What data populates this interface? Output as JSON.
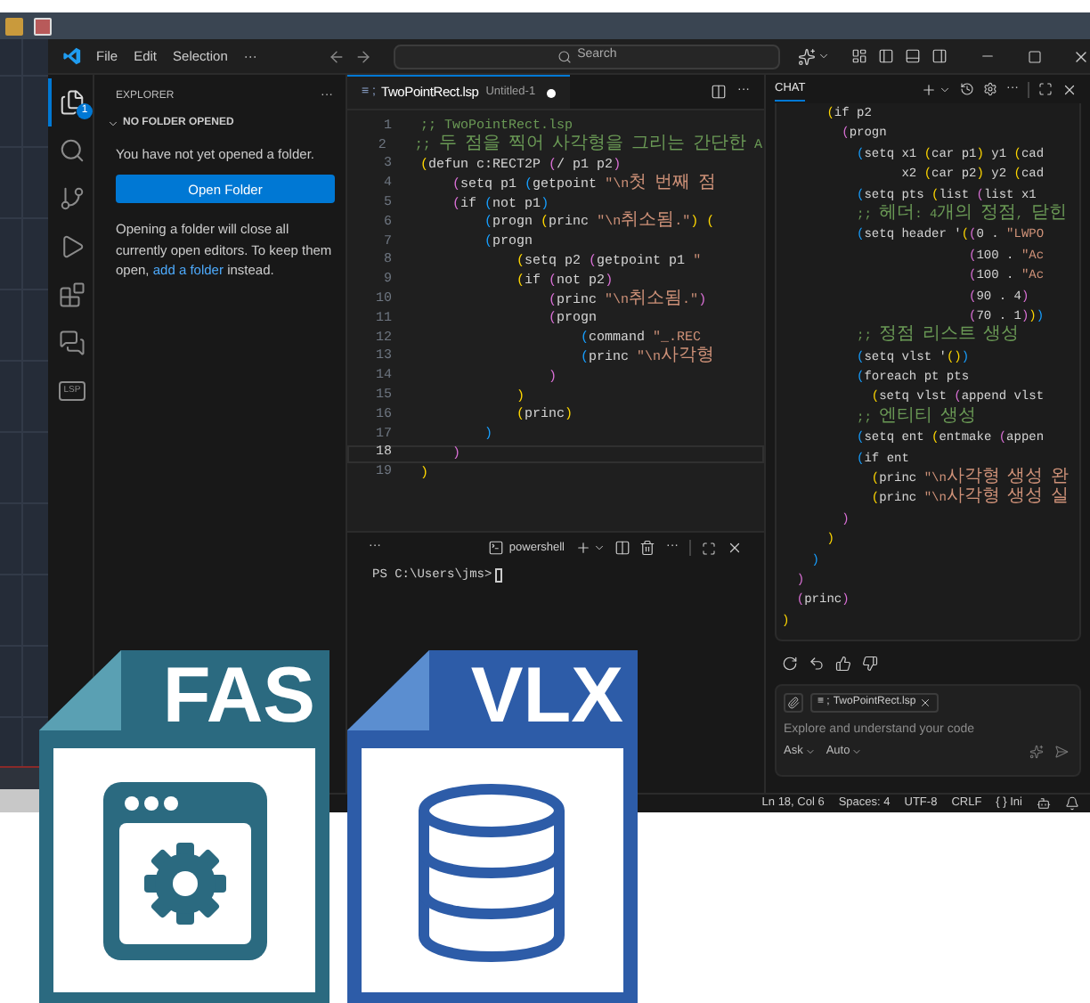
{
  "title_bar": {
    "menu": [
      "File",
      "Edit",
      "Selection",
      "···"
    ],
    "search": {
      "placeholder": "Search"
    }
  },
  "activity_bar": {
    "items": [
      {
        "kind": "files",
        "selected": true,
        "badge": "1"
      },
      {
        "kind": "search",
        "selected": false
      },
      {
        "kind": "source-control",
        "selected": false
      },
      {
        "kind": "run",
        "selected": false
      },
      {
        "kind": "extensions",
        "selected": false
      },
      {
        "kind": "chat",
        "selected": false
      },
      {
        "kind": "lsp",
        "selected": false,
        "label": "LSP"
      }
    ]
  },
  "explorer": {
    "title": "EXPLORER",
    "more": "···",
    "section": {
      "title": "NO FOLDER OPENED",
      "expanded": true
    },
    "message": "You have not yet opened a folder.",
    "button": "Open Folder",
    "note": {
      "before": "Opening a folder will close all currently open editors. To keep them open, ",
      "link": "add a folder",
      "after": " instead."
    }
  },
  "editor": {
    "tabs": [
      {
        "icon": "≡ ;",
        "name": "TwoPointRect.lsp",
        "detail": "Untitled-1",
        "modified": true,
        "selected": true
      }
    ],
    "more": "···",
    "lines": [
      {
        "number": "1",
        "current": false,
        "spans": [
          {
            "kind": "comment",
            "text": ";; TwoPointRect.lsp"
          }
        ]
      },
      {
        "number": "2",
        "current": false,
        "spans": [
          {
            "kind": "comment",
            "text": ";; 두 점을 찍어 사각형을 그리는 간단한 A"
          }
        ]
      },
      {
        "number": "3",
        "current": false,
        "spans": [
          {
            "kind": "bracket1",
            "text": "("
          },
          {
            "kind": "plain",
            "text": "defun c:RECT2P "
          },
          {
            "kind": "bracket2",
            "text": "("
          },
          {
            "kind": "plain",
            "text": "/ p1 p2"
          },
          {
            "kind": "bracket2",
            "text": ")"
          }
        ]
      },
      {
        "number": "4",
        "current": false,
        "spans": [
          {
            "kind": "bracket2",
            "text": "    ("
          },
          {
            "kind": "plain",
            "text": "setq p1 "
          },
          {
            "kind": "bracket3",
            "text": "("
          },
          {
            "kind": "plain",
            "text": "getpoint "
          },
          {
            "kind": "string",
            "text": "\"\\n첫 번째 점"
          }
        ]
      },
      {
        "number": "5",
        "current": false,
        "spans": [
          {
            "kind": "bracket2",
            "text": "    ("
          },
          {
            "kind": "plain",
            "text": "if "
          },
          {
            "kind": "bracket3",
            "text": "("
          },
          {
            "kind": "plain",
            "text": "not p1"
          },
          {
            "kind": "bracket3",
            "text": ")"
          }
        ]
      },
      {
        "number": "6",
        "current": false,
        "spans": [
          {
            "kind": "bracket3",
            "text": "        ("
          },
          {
            "kind": "plain",
            "text": "progn "
          },
          {
            "kind": "bracket1",
            "text": "("
          },
          {
            "kind": "plain",
            "text": "princ "
          },
          {
            "kind": "string",
            "text": "\"\\n취소됨.\""
          },
          {
            "kind": "bracket1",
            "text": ") ("
          }
        ]
      },
      {
        "number": "7",
        "current": false,
        "spans": [
          {
            "kind": "bracket3",
            "text": "        ("
          },
          {
            "kind": "plain",
            "text": "progn"
          }
        ]
      },
      {
        "number": "8",
        "current": false,
        "spans": [
          {
            "kind": "bracket1",
            "text": "            ("
          },
          {
            "kind": "plain",
            "text": "setq p2 "
          },
          {
            "kind": "bracket2",
            "text": "("
          },
          {
            "kind": "plain",
            "text": "getpoint p1 "
          },
          {
            "kind": "string",
            "text": "\""
          }
        ]
      },
      {
        "number": "9",
        "current": false,
        "spans": [
          {
            "kind": "bracket1",
            "text": "            ("
          },
          {
            "kind": "plain",
            "text": "if "
          },
          {
            "kind": "bracket2",
            "text": "("
          },
          {
            "kind": "plain",
            "text": "not p2"
          },
          {
            "kind": "bracket2",
            "text": ")"
          }
        ]
      },
      {
        "number": "10",
        "current": false,
        "spans": [
          {
            "kind": "bracket2",
            "text": "                ("
          },
          {
            "kind": "plain",
            "text": "princ "
          },
          {
            "kind": "string",
            "text": "\"\\n취소됨.\""
          },
          {
            "kind": "bracket2",
            "text": ")"
          }
        ]
      },
      {
        "number": "11",
        "current": false,
        "spans": [
          {
            "kind": "bracket2",
            "text": "                ("
          },
          {
            "kind": "plain",
            "text": "progn"
          }
        ]
      },
      {
        "number": "12",
        "current": false,
        "spans": [
          {
            "kind": "bracket3",
            "text": "                    ("
          },
          {
            "kind": "plain",
            "text": "command "
          },
          {
            "kind": "string",
            "text": "\"_.REC"
          }
        ]
      },
      {
        "number": "13",
        "current": false,
        "spans": [
          {
            "kind": "bracket3",
            "text": "                    ("
          },
          {
            "kind": "plain",
            "text": "princ "
          },
          {
            "kind": "string",
            "text": "\"\\n사각형"
          }
        ]
      },
      {
        "number": "14",
        "current": false,
        "spans": [
          {
            "kind": "bracket2",
            "text": "                )"
          }
        ]
      },
      {
        "number": "15",
        "current": false,
        "spans": [
          {
            "kind": "bracket1",
            "text": "            )"
          }
        ]
      },
      {
        "number": "16",
        "current": false,
        "spans": [
          {
            "kind": "bracket1",
            "text": "            ("
          },
          {
            "kind": "plain",
            "text": "princ"
          },
          {
            "kind": "bracket1",
            "text": ")"
          }
        ]
      },
      {
        "number": "17",
        "current": false,
        "spans": [
          {
            "kind": "bracket3",
            "text": "        )"
          }
        ]
      },
      {
        "number": "18",
        "current": true,
        "spans": [
          {
            "kind": "bracket2",
            "text": "    )"
          }
        ]
      },
      {
        "number": "19",
        "current": false,
        "spans": [
          {
            "kind": "bracket1",
            "text": ")"
          }
        ]
      }
    ]
  },
  "terminal": {
    "more": "···",
    "shell": "powershell",
    "actions_more": "···",
    "prompt": "PS C:\\Users\\jms>"
  },
  "chat": {
    "tabs": [
      {
        "label": "CHAT",
        "selected": true
      }
    ],
    "more": "···",
    "code": [
      [
        {
          "kind": "bracket1",
          "text": "      ("
        },
        {
          "kind": "plain",
          "text": "if p2"
        }
      ],
      [
        {
          "kind": "bracket2",
          "text": "        ("
        },
        {
          "kind": "plain",
          "text": "progn"
        }
      ],
      [
        {
          "kind": "bracket3",
          "text": "          ("
        },
        {
          "kind": "plain",
          "text": "setq x1 "
        },
        {
          "kind": "bracket1",
          "text": "("
        },
        {
          "kind": "plain",
          "text": "car p1"
        },
        {
          "kind": "bracket1",
          "text": ")"
        },
        {
          "kind": "plain",
          "text": " y1 "
        },
        {
          "kind": "bracket1",
          "text": "("
        },
        {
          "kind": "plain",
          "text": "cad"
        }
      ],
      [
        {
          "kind": "plain",
          "text": "                x2 "
        },
        {
          "kind": "bracket1",
          "text": "("
        },
        {
          "kind": "plain",
          "text": "car p2"
        },
        {
          "kind": "bracket1",
          "text": ")"
        },
        {
          "kind": "plain",
          "text": " y2 "
        },
        {
          "kind": "bracket1",
          "text": "("
        },
        {
          "kind": "plain",
          "text": "cad"
        }
      ],
      [
        {
          "kind": "bracket3",
          "text": "          ("
        },
        {
          "kind": "plain",
          "text": "setq pts "
        },
        {
          "kind": "bracket1",
          "text": "("
        },
        {
          "kind": "plain",
          "text": "list "
        },
        {
          "kind": "bracket2",
          "text": "("
        },
        {
          "kind": "plain",
          "text": "list x1"
        }
      ],
      [
        {
          "kind": "comment",
          "text": "          ;; 헤더: 4개의 정점, 닫힌"
        }
      ],
      [
        {
          "kind": "bracket3",
          "text": "          ("
        },
        {
          "kind": "plain",
          "text": "setq header '"
        },
        {
          "kind": "bracket1",
          "text": "("
        },
        {
          "kind": "bracket2",
          "text": "("
        },
        {
          "kind": "plain",
          "text": "0 . "
        },
        {
          "kind": "string",
          "text": "\"LWPO"
        }
      ],
      [
        {
          "kind": "bracket2",
          "text": "                         ("
        },
        {
          "kind": "plain",
          "text": "100 . "
        },
        {
          "kind": "string",
          "text": "\"Ac"
        }
      ],
      [
        {
          "kind": "bracket2",
          "text": "                         ("
        },
        {
          "kind": "plain",
          "text": "100 . "
        },
        {
          "kind": "string",
          "text": "\"Ac"
        }
      ],
      [
        {
          "kind": "bracket2",
          "text": "                         ("
        },
        {
          "kind": "plain",
          "text": "90 . 4"
        },
        {
          "kind": "bracket2",
          "text": ")"
        }
      ],
      [
        {
          "kind": "bracket2",
          "text": "                         ("
        },
        {
          "kind": "plain",
          "text": "70 . 1"
        },
        {
          "kind": "bracket2",
          "text": ")"
        },
        {
          "kind": "bracket1",
          "text": ")"
        },
        {
          "kind": "bracket3",
          "text": ")"
        }
      ],
      [
        {
          "kind": "comment",
          "text": "          ;; 정점 리스트 생성"
        }
      ],
      [
        {
          "kind": "bracket3",
          "text": "          ("
        },
        {
          "kind": "plain",
          "text": "setq vlst '"
        },
        {
          "kind": "bracket1",
          "text": "()"
        },
        {
          "kind": "bracket3",
          "text": ")"
        }
      ],
      [
        {
          "kind": "bracket3",
          "text": "          ("
        },
        {
          "kind": "plain",
          "text": "foreach pt pts"
        }
      ],
      [
        {
          "kind": "bracket1",
          "text": "            ("
        },
        {
          "kind": "plain",
          "text": "setq vlst "
        },
        {
          "kind": "bracket2",
          "text": "("
        },
        {
          "kind": "plain",
          "text": "append vlst"
        }
      ],
      [
        {
          "kind": "comment",
          "text": "          ;; 엔티티 생성"
        }
      ],
      [
        {
          "kind": "bracket3",
          "text": "          ("
        },
        {
          "kind": "plain",
          "text": "setq ent "
        },
        {
          "kind": "bracket1",
          "text": "("
        },
        {
          "kind": "plain",
          "text": "entmake "
        },
        {
          "kind": "bracket2",
          "text": "("
        },
        {
          "kind": "plain",
          "text": "appen"
        }
      ],
      [
        {
          "kind": "bracket3",
          "text": "          ("
        },
        {
          "kind": "plain",
          "text": "if ent"
        }
      ],
      [
        {
          "kind": "bracket1",
          "text": "            ("
        },
        {
          "kind": "plain",
          "text": "princ "
        },
        {
          "kind": "string",
          "text": "\"\\n사각형 생성 완"
        }
      ],
      [
        {
          "kind": "bracket1",
          "text": "            ("
        },
        {
          "kind": "plain",
          "text": "princ "
        },
        {
          "kind": "string",
          "text": "\"\\n사각형 생성 실"
        }
      ],
      [
        {
          "kind": "bracket2",
          "text": "        )"
        }
      ],
      [
        {
          "kind": "bracket1",
          "text": "      )"
        }
      ],
      [
        {
          "kind": "bracket3",
          "text": "    )"
        }
      ],
      [
        {
          "kind": "bracket2",
          "text": "  )"
        }
      ],
      [
        {
          "kind": "bracket2",
          "text": "  ("
        },
        {
          "kind": "plain",
          "text": "princ"
        },
        {
          "kind": "bracket2",
          "text": ")"
        }
      ],
      [
        {
          "kind": "bracket1",
          "text": ")"
        }
      ]
    ],
    "input": {
      "chip": {
        "icon": "≡ ;",
        "name": "TwoPointRect.lsp"
      },
      "placeholder": "Explore and understand your code",
      "mode": "Ask",
      "model": "Auto"
    }
  },
  "status_bar": {
    "items": [
      "Ln 18, Col 6",
      "Spaces: 4",
      "UTF-8",
      "CRLF",
      "{ } Ini"
    ]
  },
  "badges": [
    {
      "label": "FAS",
      "kind": "app"
    },
    {
      "label": "VLX",
      "kind": "database"
    }
  ]
}
